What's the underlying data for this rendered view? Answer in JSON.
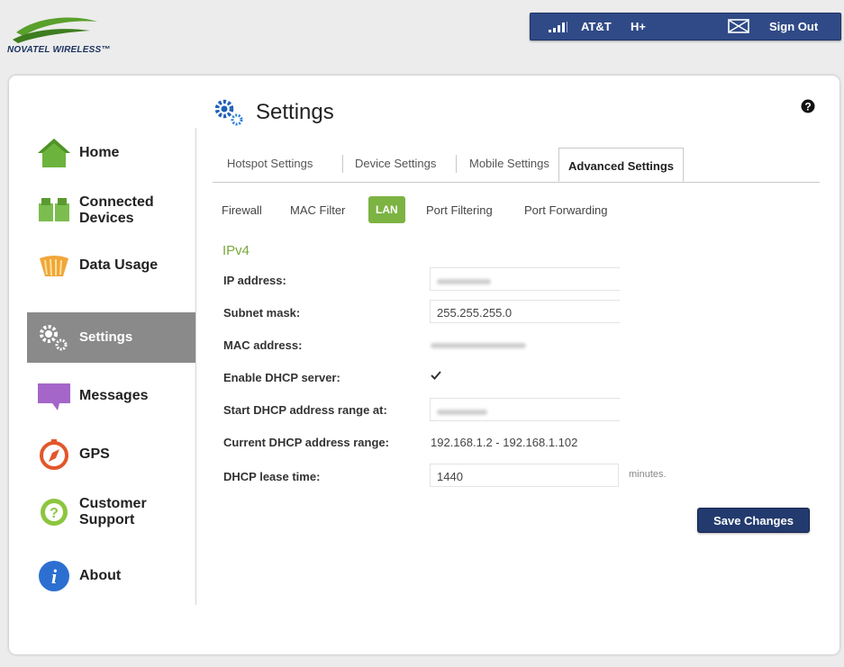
{
  "brand": {
    "name": "NOVATEL WIRELESS",
    "tm": "™"
  },
  "status": {
    "carrier": "AT&T",
    "network": "H+",
    "sign_out": "Sign Out"
  },
  "sidebar": {
    "items": [
      {
        "line1": "Home",
        "line2": ""
      },
      {
        "line1": "Connected",
        "line2": "Devices"
      },
      {
        "line1": "Data Usage",
        "line2": ""
      },
      {
        "line1": "Settings",
        "line2": "",
        "active": true
      },
      {
        "line1": "Messages",
        "line2": ""
      },
      {
        "line1": "GPS",
        "line2": ""
      },
      {
        "line1": "Customer",
        "line2": "Support"
      },
      {
        "line1": "About",
        "line2": ""
      }
    ]
  },
  "header": {
    "title": "Settings"
  },
  "tabs": [
    "Hotspot Settings",
    "Device Settings",
    "Mobile Settings",
    "Advanced Settings"
  ],
  "active_tab": "Advanced Settings",
  "subtabs": [
    "Firewall",
    "MAC Filter",
    "LAN",
    "Port Filtering",
    "Port Forwarding"
  ],
  "active_subtab": "LAN",
  "section": {
    "title": "IPv4"
  },
  "form": {
    "ip_address": {
      "label": "IP address:",
      "value": ""
    },
    "subnet_mask": {
      "label": "Subnet mask:",
      "value": "255.255.255.0"
    },
    "mac_address": {
      "label": "MAC address:",
      "value": ""
    },
    "dhcp_enable": {
      "label": "Enable DHCP server:",
      "checked": true
    },
    "dhcp_start": {
      "label": "Start DHCP address range at:",
      "value": ""
    },
    "dhcp_range": {
      "label": "Current DHCP address range:",
      "value": "192.168.1.2 - 192.168.1.102"
    },
    "lease_time": {
      "label": "DHCP lease time:",
      "value": "1440",
      "unit": "minutes."
    }
  },
  "actions": {
    "save": "Save Changes"
  },
  "colors": {
    "navy": "#233a6e",
    "green": "#7cb342",
    "active_nav": "#8a8a8a"
  }
}
